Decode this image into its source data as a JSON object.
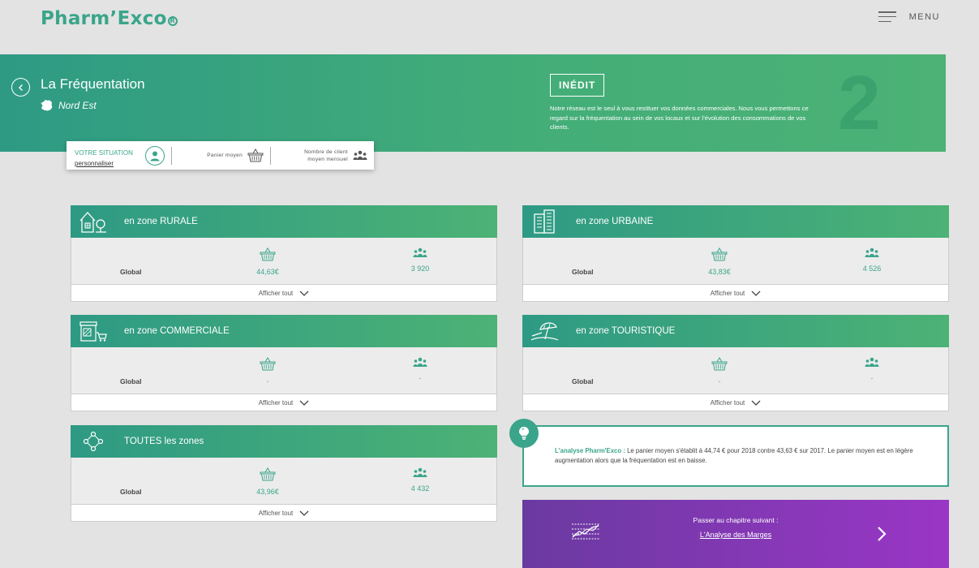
{
  "header": {
    "logo": "Pharm’Exco",
    "logo_mark": "R",
    "menu_label": "MENU"
  },
  "hero": {
    "title": "La Fréquentation",
    "region": "Nord Est",
    "badge": "INÉDIT",
    "description": "Notre réseau est le seul à vous restituer vos données commerciales. Nous vous permettons ce regard sur la fréquentation au sein de vos locaux et sur l’évolution des consommations de vos clients.",
    "chapter_number": "2"
  },
  "situation": {
    "title": "VOTRE SITUATION",
    "link": "personnaliser",
    "panier_label": "Panier moyen",
    "clients_label_1": "Nombre de client",
    "clients_label_2": "moyen mensuel"
  },
  "cards": {
    "rurale": {
      "title": "en zone RURALE",
      "row_label": "Global",
      "panier": "44,63€",
      "clients": "3 920",
      "footer": "Afficher tout"
    },
    "urbaine": {
      "title": "en zone URBAINE",
      "row_label": "Global",
      "panier": "43,83€",
      "clients": "4 526",
      "footer": "Afficher tout"
    },
    "commerciale": {
      "title": "en zone COMMERCIALE",
      "row_label": "Global",
      "panier": "-",
      "clients": "-",
      "footer": "Afficher tout"
    },
    "touristique": {
      "title": "en zone TOURISTIQUE",
      "row_label": "Global",
      "panier": "-",
      "clients": "-",
      "footer": "Afficher tout"
    },
    "toutes": {
      "title": "TOUTES les zones",
      "row_label": "Global",
      "panier": "43,96€",
      "clients": "4 432",
      "footer": "Afficher tout"
    }
  },
  "analyse": {
    "title": "L'analyse Pharm'Exco :",
    "text": "Le panier moyen s'établit à 44,74 € pour 2018 contre 43,63 € sur 2017. Le panier moyen est en légère augmentation alors que la fréquentation est en baisse."
  },
  "next_chapter": {
    "label": "Passer au chapitre suivant :",
    "link": "L'Analyse des Marges"
  },
  "colors": {
    "accent": "#3aa58a",
    "purple": "#7b36b0",
    "background": "#e3e3e3"
  }
}
